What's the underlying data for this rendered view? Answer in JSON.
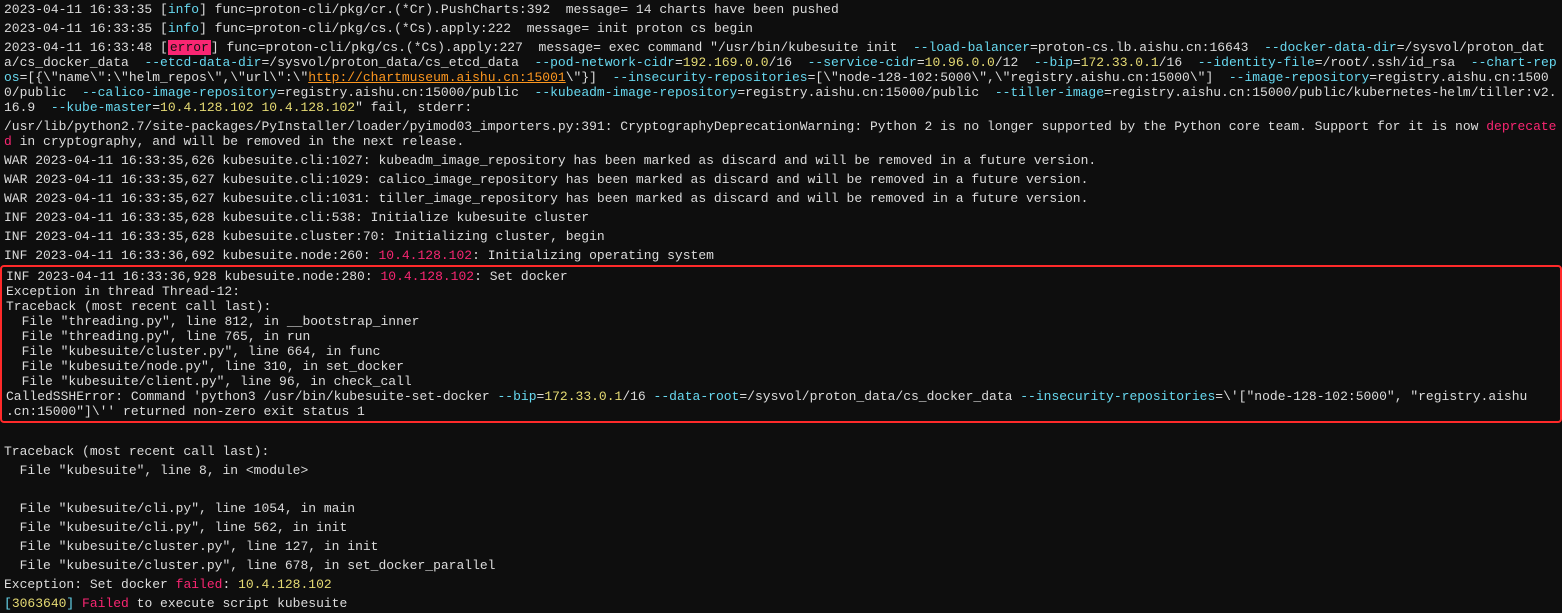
{
  "lines": {
    "l1": {
      "ts": "2023-04-11 16:33:35",
      "info": "info",
      "body1": "] func=proton-cli/pkg/cr.(*Cr).PushCharts:392  message= 14 charts have been pushed"
    },
    "l2": {
      "ts": "2023-04-11 16:33:35",
      "info": "info",
      "body1": "] func=proton-cli/pkg/cs.(*Cs).apply:222  message= init proton cs begin"
    },
    "l3": {
      "ts": "2023-04-11 16:33:48",
      "err": "error",
      "body1": "] func=proton-cli/pkg/cs.(*Cs).apply:227  message= exec command \"/usr/bin/kubesuite init  ",
      "f_lb": "--load-balancer",
      "v_lb": "=proton-cs.lb.aishu.cn:16643  ",
      "f_dd": "--docker-data-dir",
      "v_dd": "=/sysvol/proton_d",
      "body2": "ata/cs_docker_data  ",
      "f_ed": "--etcd-data-dir",
      "v_ed": "=/sysvol/proton_data/cs_etcd_data  ",
      "f_pn": "--pod-network-cidr",
      "v_pn_eq": "=",
      "v_pn_ip": "192.169.0.0",
      "v_pn_mask": "/16  ",
      "f_sc": "--service-cidr",
      "v_sc_eq": "=",
      "v_sc_ip": "10.96.0.0",
      "v_sc_mask": "/12  ",
      "f_bip": "--bip",
      "v_bip_eq": "=",
      "v_bip_ip": "172.33.0.1",
      "v_bip_mask": "/16  ",
      "f_id": "--identity-file",
      "v_id": "=/root/.ssh/id_rsa  ",
      "f_chr": "--cha",
      "l4a": "rt-repos",
      "l4b": "=[{\\\"name\\\":\\\"helm_repos\\\",\\\"url\\\":\\\"",
      "url": "http://chartmuseum.aishu.cn:15001",
      "l4c": "\\\"}]  ",
      "f_ir": "--insecurity-repositories",
      "v_ir": "=[\\\"node-128-102:5000\\\",\\\"registry.aishu.cn:15000\\\"]  ",
      "f_im": "--image-repository",
      "v_im": "=registry.aish",
      "l5a": "u.cn:15000/public  ",
      "f_cir": "--calico-image-repository",
      "v_cir": "=registry.aishu.cn:15000/public  ",
      "f_kir": "--kubeadm-image-repository",
      "v_kir": "=registry.aishu.cn:15000/public  ",
      "f_tir": "--tiller-image",
      "v_tir": "=registry.aishu.cn:15000/public/kubernetes-he",
      "l6a": "lm/tiller:v2.16.9  ",
      "f_km": "--kube-master",
      "v_km_eq": "=",
      "v_km_ip1": "10.4.128.102",
      "v_km_sp": " ",
      "v_km_ip2": "10.4.128.102",
      "l6b": "\" fail, stderr:"
    },
    "l7": {
      "a": "/usr/lib/python2.7/site-packages/PyInstaller/loader/pyimod03_importers.py:391: CryptographyDeprecationWarning: Python 2 is no longer supported by the Python core team. Support for it is now ",
      "depre": "depre",
      "cated": "cated",
      "b": " in cryptography, and will be removed in the next release."
    },
    "war1": "WAR 2023-04-11 16:33:35,626 kubesuite.cli:1027: kubeadm_image_repository has been marked as discard and will be removed in a future version.",
    "war2": "WAR 2023-04-11 16:33:35,627 kubesuite.cli:1029: calico_image_repository has been marked as discard and will be removed in a future version.",
    "war3": "WAR 2023-04-11 16:33:35,627 kubesuite.cli:1031: tiller_image_repository has been marked as discard and will be removed in a future version.",
    "inf1": "INF 2023-04-11 16:33:35,628 kubesuite.cli:538: Initialize kubesuite cluster",
    "inf2": "INF 2023-04-11 16:33:35,628 kubesuite.cluster:70: Initializing cluster, begin",
    "inf3a": "INF 2023-04-11 16:33:36,692 kubesuite.node:260: ",
    "inf3ip": "10.4.128.102",
    "inf3b": ": Initializing operating system",
    "box": {
      "inf4a": "INF 2023-04-11 16:33:36,928 kubesuite.node:280: ",
      "inf4ip": "10.4.128.102",
      "inf4b": ": Set docker",
      "ex1": "Exception in thread Thread-12:",
      "tb1": "Traceback (most recent call last):",
      "f1": "  File \"threading.py\", line 812, in __bootstrap_inner",
      "f2": "  File \"threading.py\", line 765, in run",
      "f3": "  File \"kubesuite/cluster.py\", line 664, in func",
      "f4": "  File \"kubesuite/node.py\", line 310, in set_docker",
      "f5": "  File \"kubesuite/client.py\", line 96, in check_call",
      "ce1": "CalledSSHError: Command 'python3 /usr/bin/kubesuite-set-docker ",
      "ce_bip": "--bip",
      "ce_bip_eq": "=",
      "ce_bip_ip": "172.33.0.1",
      "ce_bip_mask": "/16 ",
      "ce_dr": "--data-root",
      "ce_dr_v": "=/sysvol/proton_data/cs_docker_data ",
      "ce_ir": "--insecurity-repositories",
      "ce_ir_v": "=\\'[\"node-128-102:5000\", \"registry.aishu",
      "ce2": ".cn:15000\"]\\'' returned non-zero exit status 1"
    },
    "gap": " ",
    "tb2": "Traceback (most recent call last):",
    "bf1": "  File \"kubesuite\", line 8, in <module>",
    "bfblank": " ",
    "bf2": "  File \"kubesuite/cli.py\", line 1054, in main",
    "bf3": "  File \"kubesuite/cli.py\", line 562, in init",
    "bf4": "  File \"kubesuite/cluster.py\", line 127, in init",
    "bf5": "  File \"kubesuite/cluster.py\", line 678, in set_docker_parallel",
    "exc_a": "Exception: Set docker ",
    "exc_f": "failed",
    "exc_b": ": ",
    "exc_ip": "10.4.128.102",
    "last_a": "[",
    "last_n": "3063640",
    "last_b": "] ",
    "last_f": "Failed",
    "last_c": " to execute script kubesuite"
  }
}
